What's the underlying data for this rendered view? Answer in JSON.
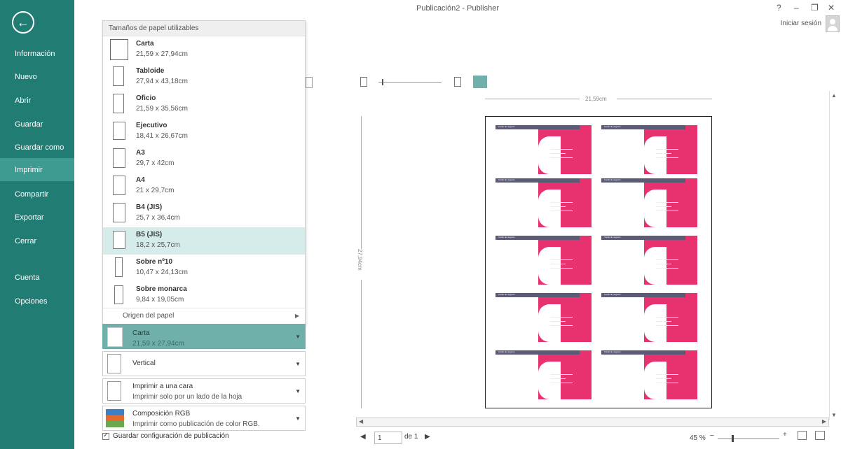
{
  "window": {
    "title": "Publicación2 - Publisher",
    "help": "?",
    "signin": "Iniciar sesión"
  },
  "sidebar": {
    "back_icon": "back-arrow-icon",
    "items": [
      {
        "label": "Información"
      },
      {
        "label": "Nuevo"
      },
      {
        "label": "Abrir"
      },
      {
        "label": "Guardar"
      },
      {
        "label": "Guardar como"
      },
      {
        "label": "Imprimir",
        "active": true
      },
      {
        "label": "Compartir"
      },
      {
        "label": "Exportar"
      },
      {
        "label": "Cerrar"
      },
      {
        "label": "Cuenta"
      },
      {
        "label": "Opciones"
      }
    ]
  },
  "paper_sizes": {
    "header": "Tamaños de papel utilizables",
    "items": [
      {
        "name": "Carta",
        "dims": "21,59 x 27,94cm"
      },
      {
        "name": "Tabloide",
        "dims": "27,94 x 43,18cm"
      },
      {
        "name": "Oficio",
        "dims": "21,59 x 35,56cm"
      },
      {
        "name": "Ejecutivo",
        "dims": "18,41 x 26,67cm"
      },
      {
        "name": "A3",
        "dims": "29,7 x 42cm"
      },
      {
        "name": "A4",
        "dims": "21 x 29,7cm"
      },
      {
        "name": "B4 (JIS)",
        "dims": "25,7 x 36,4cm"
      },
      {
        "name": "B5 (JIS)",
        "dims": "18,2 x 25,7cm",
        "selected": true
      },
      {
        "name": "Sobre nº10",
        "dims": "10,47 x 24,13cm"
      },
      {
        "name": "Sobre monarca",
        "dims": "9,84 x 19,05cm"
      }
    ],
    "origin": "Origen del papel"
  },
  "settings": {
    "paper": {
      "label": "Carta",
      "sub": "21,59 x 27,94cm"
    },
    "orientation": {
      "label": "Vertical"
    },
    "sides": {
      "label": "Imprimir a una cara",
      "sub": "Imprimir solo por un lado de la hoja"
    },
    "color": {
      "label": "Composición RGB",
      "sub": "Imprimir como publicación de color RGB."
    },
    "save_config": "Guardar configuración de publicación"
  },
  "preview": {
    "width_label": "21,59cm",
    "height_label": "27,94cm",
    "card_title": "Cartel de negocio"
  },
  "status": {
    "page": "1",
    "of": "de 1",
    "zoom": "45 %"
  },
  "colors": {
    "sidebar": "#217d74",
    "accent_pink": "#e8316f",
    "card_bar": "#5c5b76",
    "selected_row": "#d6ecea"
  }
}
